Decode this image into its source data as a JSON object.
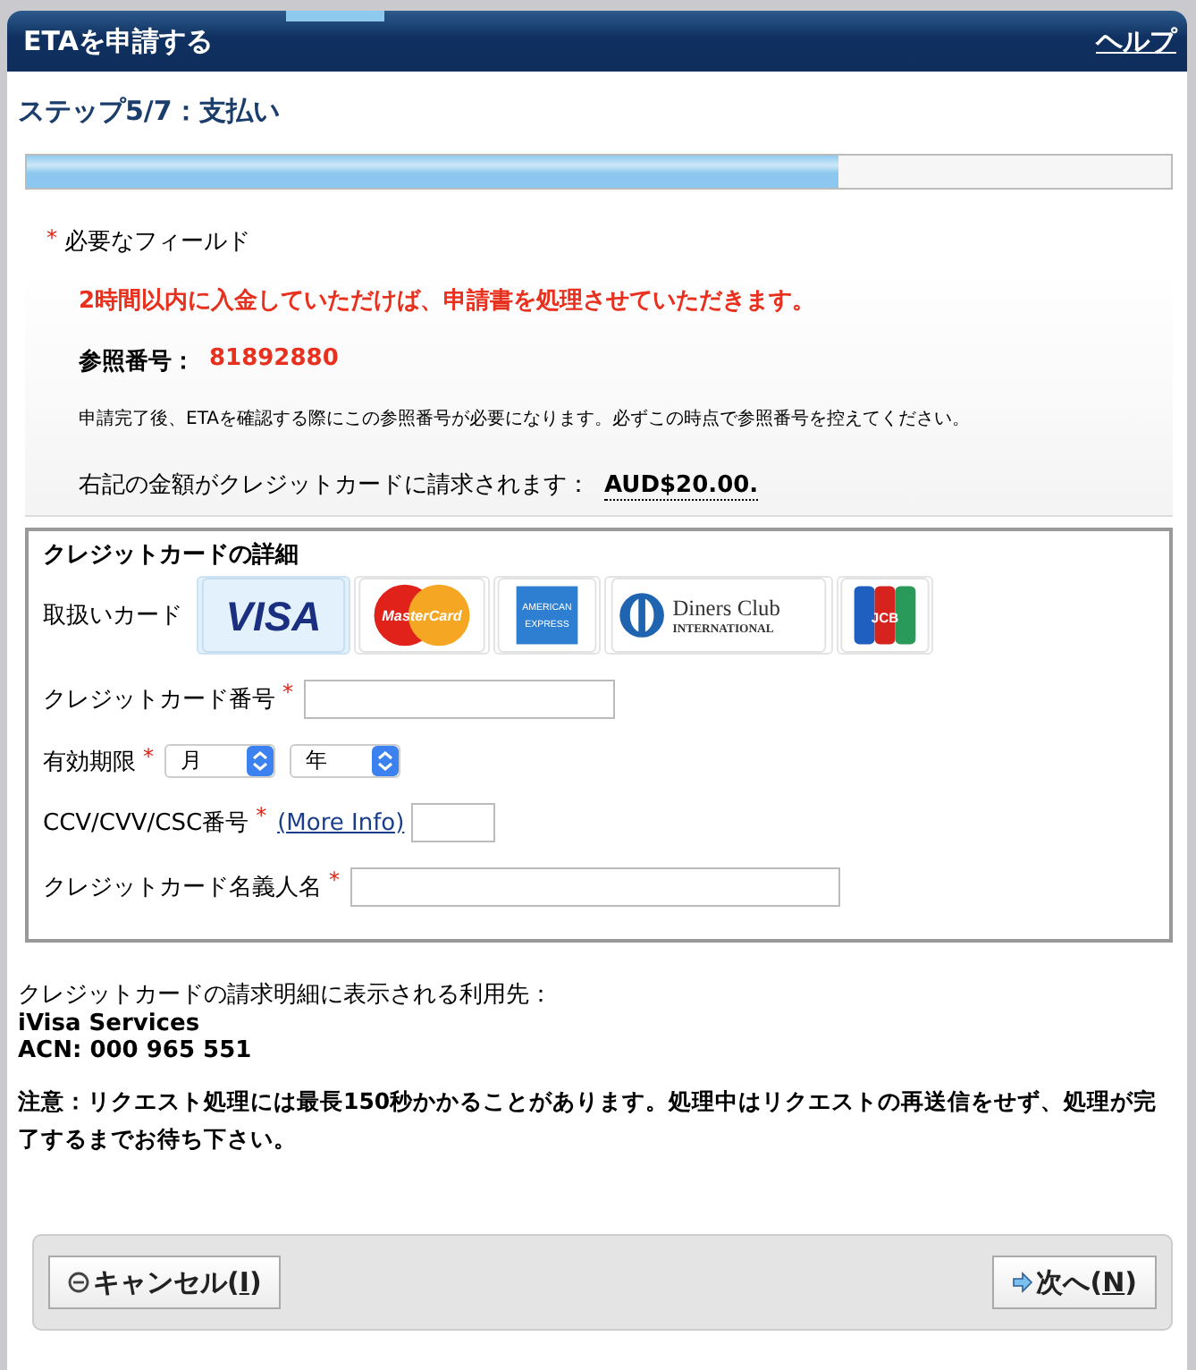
{
  "window": {
    "title": "ETAを申請する",
    "help_link": "ヘルプ"
  },
  "step": {
    "title": "ステップ5/7：支払い",
    "level": 0.71
  },
  "required_note": {
    "mark": "*",
    "text": "必要なフィールド"
  },
  "notice": {
    "warning": "2時間以内に入金していただけば、申請書を処理させていただきます。",
    "reference_label": "参照番号：",
    "reference_number": "81892880",
    "reference_hint": "申請完了後、ETAを確認する際にこの参照番号が必要になります。必ずこの時点で参照番号を控えてください。",
    "charge_text": "右記の金額がクレジットカードに請求されます：",
    "charge_amount": "AUD$20.00."
  },
  "card_details": {
    "legend": "クレジットカードの詳細",
    "accepted_label": "取扱いカード",
    "cards": [
      {
        "kind": "visa",
        "texts": [
          "VISA"
        ],
        "selected": true
      },
      {
        "kind": "mastercard",
        "texts": [
          "MasterCard"
        ],
        "selected": false
      },
      {
        "kind": "amex",
        "texts": [
          "AMERICAN",
          "EXPRESS"
        ],
        "selected": false
      },
      {
        "kind": "diners",
        "texts": [
          "Diners Club",
          "INTERNATIONAL"
        ],
        "selected": false
      },
      {
        "kind": "jcb",
        "texts": [
          "JCB"
        ],
        "selected": false
      }
    ],
    "fields": [
      {
        "kind": "number",
        "label": "クレジットカード番号",
        "mark": "*"
      },
      {
        "kind": "expiry",
        "label": "有効期限",
        "mark": "*",
        "selects": [
          "月",
          "年"
        ]
      },
      {
        "kind": "cvv",
        "label": "CCV/CVV/CSC番号",
        "mark": "*",
        "link": "(More Info)"
      },
      {
        "kind": "holder",
        "label": "クレジットカード名義人名",
        "mark": "*"
      }
    ]
  },
  "merchant": {
    "intro": "クレジットカードの請求明細に表示される利用先：",
    "name": "iVisa Services",
    "acn": "ACN: 000 965 551"
  },
  "note": "注意：リクエスト処理には最長150秒かかることがあります。処理中はリクエストの再送信をせず、処理が完了するまでお待ち下さい。",
  "buttons": [
    {
      "kind": "cancel",
      "before": "キャンセル(",
      "key": "I",
      "after": ")"
    },
    {
      "kind": "next",
      "before": "次へ(",
      "key": "N",
      "after": ")"
    }
  ]
}
